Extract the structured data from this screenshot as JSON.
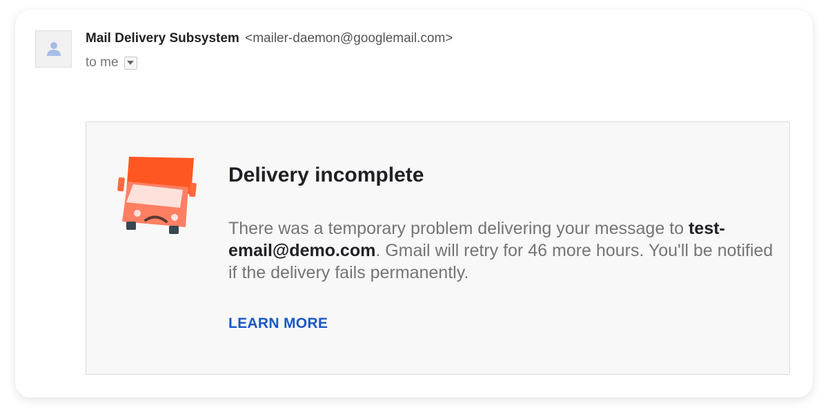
{
  "message": {
    "sender_name": "Mail Delivery Subsystem",
    "sender_email": "<mailer-daemon@googlemail.com>",
    "recipient_label": "to me"
  },
  "notice": {
    "title": "Delivery incomplete",
    "body_prefix": "There was a temporary problem delivering your message to ",
    "recipient_email": "test-email@demo.com",
    "body_suffix": ". Gmail will retry for 46 more hours. You'll be notified if the delivery fails permanently.",
    "learn_more_label": "LEARN MORE"
  },
  "icons": {
    "avatar": "person-icon",
    "dropdown": "chevron-down-icon",
    "illustration": "delivery-truck-icon"
  },
  "colors": {
    "link": "#1a57c6",
    "truck_body": "#ff5722",
    "truck_front": "#ff7f63"
  }
}
